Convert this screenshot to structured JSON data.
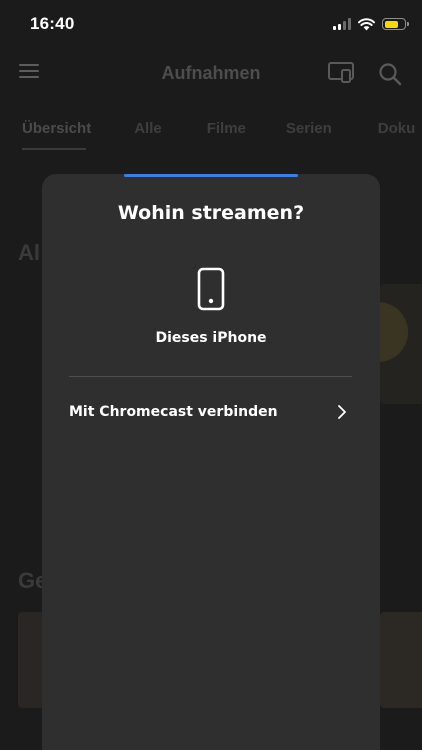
{
  "status_bar": {
    "time": "16:40",
    "battery_level": 0.7,
    "icons": [
      "cellular-signal-icon",
      "wifi-icon",
      "battery-icon"
    ]
  },
  "app": {
    "title": "Aufnahmen",
    "tabs": [
      {
        "label": "Übersicht",
        "active": true
      },
      {
        "label": "Alle"
      },
      {
        "label": "Filme"
      },
      {
        "label": "Serien"
      },
      {
        "label": "Doku"
      }
    ],
    "headings": [
      "Al",
      "Ge"
    ],
    "icons": [
      "menu-icon",
      "cast-icon",
      "search-icon"
    ]
  },
  "sheet": {
    "title": "Wohin streamen?",
    "device": {
      "icon": "phone-icon",
      "label": "Dieses iPhone"
    },
    "chromecast": {
      "label": "Mit Chromecast verbinden",
      "icon": "chevron-right-icon"
    }
  },
  "colors": {
    "accent": "#3f7ee0",
    "sheet_bg": "#2f2f2f",
    "battery": "#f5d90a"
  }
}
